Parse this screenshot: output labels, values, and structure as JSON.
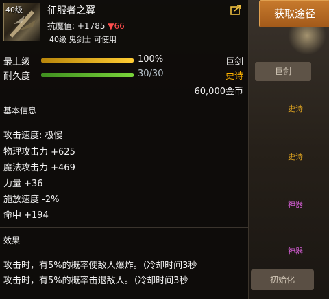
{
  "item": {
    "level_badge": "40级",
    "name": "征服者之翼",
    "resist_label": "抗魔值:",
    "resist_value": "+1785",
    "resist_diff": "▼66",
    "requirement": "40级 鬼剑士 可使用"
  },
  "stats": {
    "grade_label": "最上级",
    "grade_value": "100%",
    "grade_fill": 1.0,
    "durability_label": "耐久度",
    "durability_value": "30/30",
    "durability_fill": 1.0,
    "weapon_type": "巨剑",
    "rarity": "史诗",
    "price": "60,000金币"
  },
  "basic": {
    "title": "基本信息",
    "lines": [
      "攻击速度: 极慢",
      "物理攻击力 +625",
      "魔法攻击力 +469",
      "力量 +36",
      "施放速度 -2%",
      "命中 +194"
    ]
  },
  "effect": {
    "title": "效果",
    "lines": [
      "攻击时，有5%的概率使敌人爆炸。（冷却时间3秒",
      "攻击时，有5%的概率击退敌人。（冷却时间3秒"
    ]
  },
  "side": {
    "get_button": "获取途径",
    "bg_button_1": "巨剑",
    "tag_1": "史诗",
    "tag_2": "史诗",
    "tag_3": "神器",
    "tag_4": "神器",
    "bg_button_2": "初始化"
  },
  "colors": {
    "rarity_epic": "#ffb400",
    "grade_bar": "#ffcc33",
    "durability_bar": "#7ad43a",
    "button": "#b86a24"
  }
}
